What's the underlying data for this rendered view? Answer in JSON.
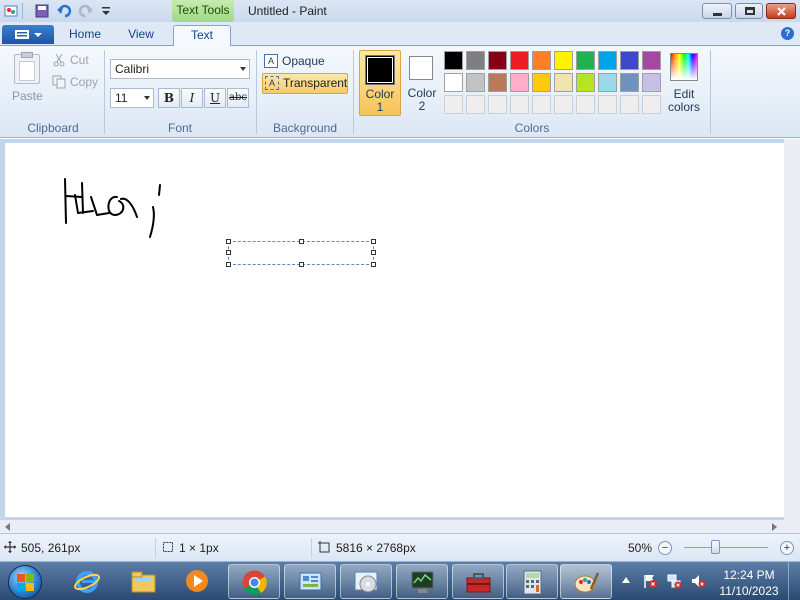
{
  "window": {
    "title": "Untitled - Paint",
    "contextual_tab": "Text Tools"
  },
  "ribbon_tabs": [
    {
      "label": "Home"
    },
    {
      "label": "View"
    },
    {
      "label": "Text",
      "active": true
    }
  ],
  "clipboard": {
    "paste_label": "Paste",
    "cut_label": "Cut",
    "copy_label": "Copy",
    "group_label": "Clipboard"
  },
  "font": {
    "family": "Calibri",
    "size": "11",
    "bold_label": "B",
    "italic_label": "I",
    "underline_label": "U",
    "strike_label": "abc",
    "group_label": "Font"
  },
  "background": {
    "opaque_label": "Opaque",
    "transparent_label": "Transparent",
    "selected": "Transparent",
    "group_label": "Background",
    "icon_glyph": "A"
  },
  "colors": {
    "color1_label_line1": "Color",
    "color1_label_line2": "1",
    "color1_value": "#000000",
    "color2_label_line1": "Color",
    "color2_label_line2": "2",
    "color2_value": "#ffffff",
    "edit_label_line1": "Edit",
    "edit_label_line2": "colors",
    "group_label": "Colors",
    "palette_row1": [
      "#000000",
      "#7f7f7f",
      "#880015",
      "#ed1c24",
      "#ff7f27",
      "#fff200",
      "#22b14c",
      "#00a2e8",
      "#3f48cc",
      "#a349a4"
    ],
    "palette_row2": [
      "#ffffff",
      "#c3c3c3",
      "#b97a57",
      "#ffaec9",
      "#ffc90e",
      "#efe4b0",
      "#b5e61d",
      "#99d9ea",
      "#7092be",
      "#c8bfe7"
    ],
    "palette_row3": [
      "#eeeeee",
      "#eeeeee",
      "#eeeeee",
      "#eeeeee",
      "#eeeeee",
      "#eeeeee",
      "#eeeeee",
      "#eeeeee",
      "#eeeeee",
      "#eeeeee"
    ]
  },
  "status": {
    "cursor_pos": "505, 261px",
    "selection_size": "1 × 1px",
    "image_size": "5816 × 2768px",
    "zoom": "50%",
    "zoom_fraction": 0.5
  },
  "taskbar": {
    "time": "12:24 PM",
    "date": "11/10/2023",
    "apps": [
      "start-orb",
      "internet-explorer",
      "file-explorer",
      "media-player",
      "chrome",
      "control-panel",
      "disc-burner",
      "network-monitor",
      "toolbox",
      "calculator",
      "paint"
    ],
    "active_app": "paint"
  }
}
